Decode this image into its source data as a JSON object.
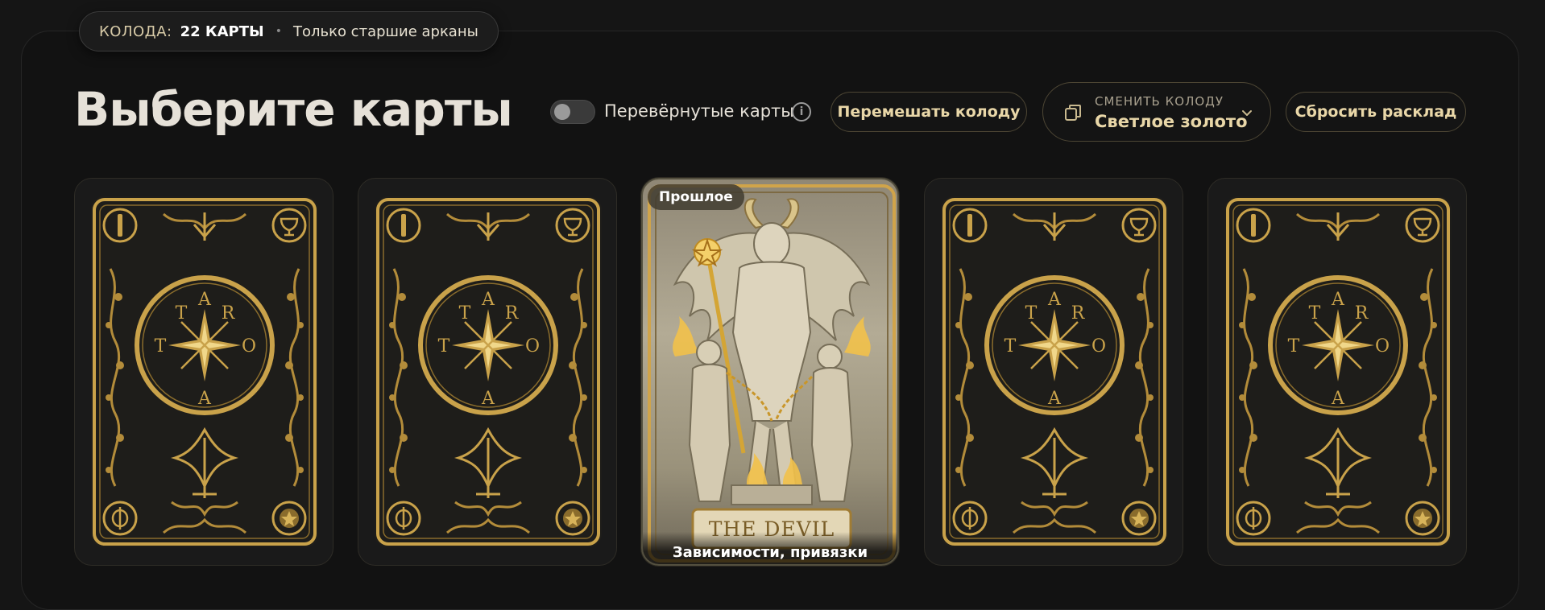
{
  "deck_info": {
    "label": "КОЛОДА:",
    "count": "22 КАРТЫ",
    "separator": "•",
    "note": "Только старшие арканы"
  },
  "header": {
    "title": "Выберите карты"
  },
  "controls": {
    "reversed_toggle": {
      "label": "Перевёрнутые карты",
      "enabled": false
    },
    "info_icon": "info-icon",
    "shuffle_label": "Перемешать колоду",
    "deck_select": {
      "label": "СМЕНИТЬ КОЛОДУ",
      "value": "Светлое золото"
    },
    "reset_label": "Сбросить расклад"
  },
  "card_back": {
    "letters": [
      "T",
      "A",
      "R",
      "O",
      "T"
    ]
  },
  "drawn_card": {
    "position_badge": "Прошлое",
    "name": "THE DEVIL",
    "meaning": "Зависимости, привязки"
  },
  "colors": {
    "gold": "#c9a24a",
    "accent_text": "#e9d7a8",
    "background": "#151515"
  }
}
